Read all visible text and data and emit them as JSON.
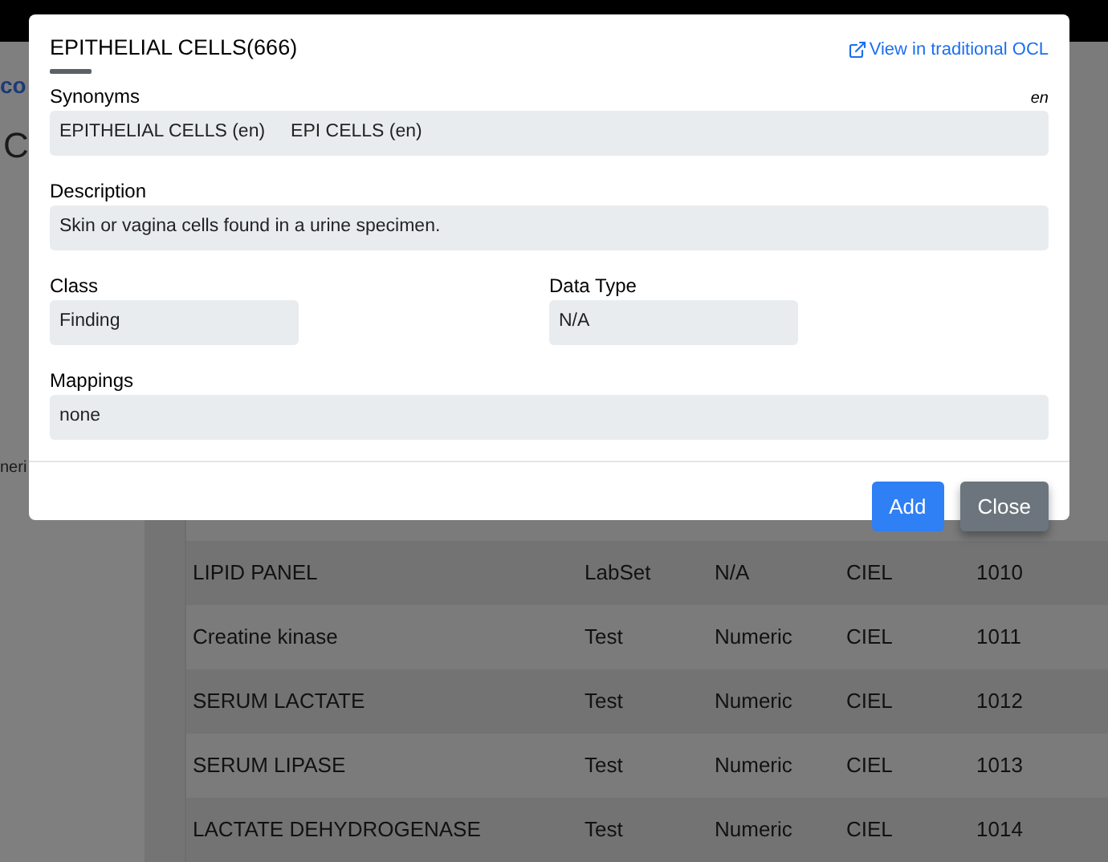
{
  "background": {
    "link_fragment": "co",
    "heading_fragment": "C",
    "sidebar_fragment": "neri",
    "table": {
      "rows": [
        {
          "name": "LIPID PANEL",
          "class": "LabSet",
          "datatype": "N/A",
          "source": "CIEL",
          "id": "1010"
        },
        {
          "name": "Creatine kinase",
          "class": "Test",
          "datatype": "Numeric",
          "source": "CIEL",
          "id": "1011"
        },
        {
          "name": "SERUM LACTATE",
          "class": "Test",
          "datatype": "Numeric",
          "source": "CIEL",
          "id": "1012"
        },
        {
          "name": "SERUM LIPASE",
          "class": "Test",
          "datatype": "Numeric",
          "source": "CIEL",
          "id": "1013"
        },
        {
          "name": "LACTATE DEHYDROGENASE",
          "class": "Test",
          "datatype": "Numeric",
          "source": "CIEL",
          "id": "1014"
        }
      ]
    }
  },
  "modal": {
    "title": "EPITHELIAL CELLS(666)",
    "link": "View in traditional OCL",
    "synonyms": {
      "label": "Synonyms",
      "locale": "en",
      "values": [
        "EPITHELIAL CELLS (en)",
        "EPI CELLS (en)"
      ]
    },
    "description": {
      "label": "Description",
      "value": "Skin or vagina cells found in a urine specimen."
    },
    "class": {
      "label": "Class",
      "value": "Finding"
    },
    "data_type": {
      "label": "Data Type",
      "value": "N/A"
    },
    "mappings": {
      "label": "Mappings",
      "value": "none"
    },
    "buttons": [
      {
        "label": "Add",
        "kind": "primary"
      },
      {
        "label": "Close",
        "kind": "secondary"
      }
    ]
  }
}
